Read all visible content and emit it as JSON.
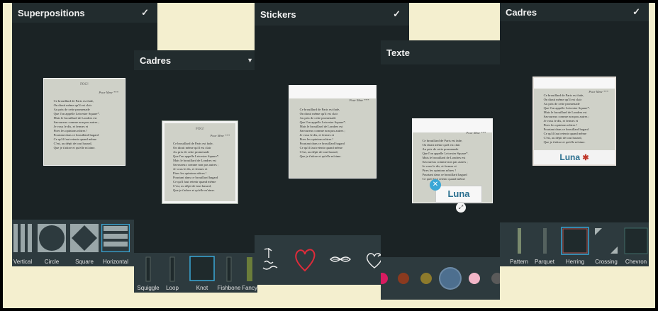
{
  "screens": {
    "superpositions": {
      "title": "Superpositions",
      "options": [
        "Vertical",
        "Circle",
        "Square",
        "Horizontal"
      ]
    },
    "cadres_frames": {
      "title": "Cadres",
      "options": [
        "Squiggle",
        "Loop",
        "Knot",
        "Fishbone",
        "Fancy"
      ]
    },
    "stickers": {
      "title": "Stickers",
      "options": [
        "thank-you-sticker",
        "heart-sticker",
        "mustache-sticker",
        "heart-outline-sticker"
      ]
    },
    "texte": {
      "title": "Texte",
      "text_value": "Luna",
      "colors": [
        "#d81b60",
        "#8b3a1f",
        "#8d7a2c",
        "#4d6f8f",
        "#f2b6c8",
        "#5a5a5a",
        "#c8c8c8"
      ]
    },
    "cadres_pattern": {
      "title": "Cadres",
      "options": [
        "Pattern",
        "Parquet",
        "Herring",
        "Crossing",
        "Chevron"
      ],
      "text_value": "Luna"
    }
  },
  "photo": {
    "title": "FOG!",
    "dedication": "Pour Mme ***",
    "poem": [
      "Ce brouillard de Paris est fade,",
      "On dirait même qu'il est clair",
      "Au prix de cette promenade",
      "Que l'on appelle Leicester Square*.",
      "Mais le brouillard de Londres est",
      "Savoureux comme non pas autres ;",
      "Je vous le dis, et fermes et",
      "Pires les opinions nôtres !",
      "Pourtant dans ce brouillard hagard",
      "Ce qu'il faut retenir quand même",
      "C'est, au dépit de tout hasard,",
      "Que je t'adore et qu'elle m'aime."
    ]
  },
  "colors": {
    "panel": "#1b2325",
    "header": "#222c2e",
    "tray": "#2d3a3e",
    "accent": "#3aa7d6",
    "background": "#f4efcf"
  }
}
